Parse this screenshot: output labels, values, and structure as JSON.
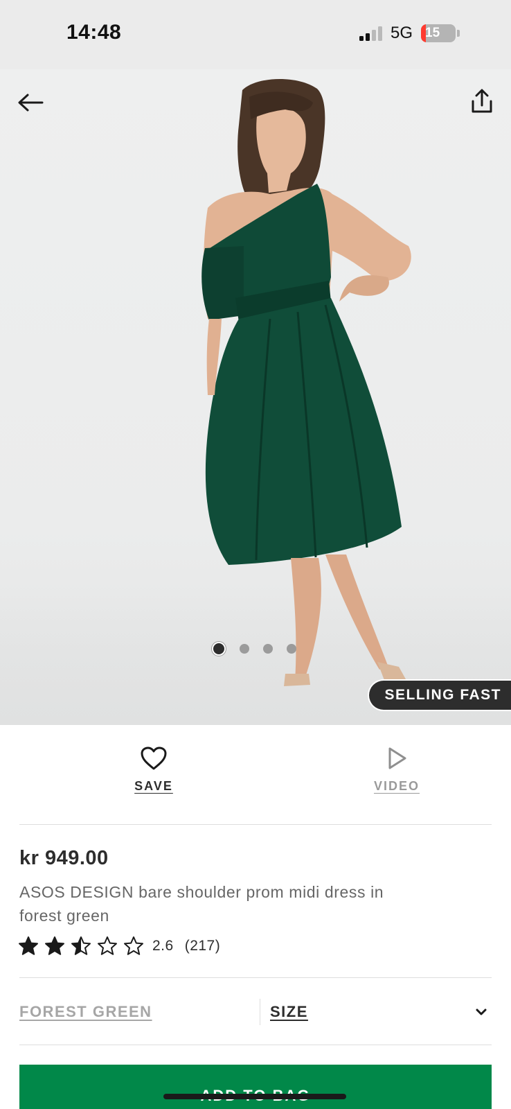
{
  "status_bar": {
    "time": "14:48",
    "network": "5G",
    "battery": "15"
  },
  "hero": {
    "back_icon": "arrow-left-icon",
    "share_icon": "share-icon",
    "badge": "SELLING FAST",
    "carousel": {
      "count": 4,
      "active_index": 0
    }
  },
  "actions": {
    "save_label": "SAVE",
    "save_icon": "heart-icon",
    "video_label": "VIDEO",
    "video_icon": "play-icon"
  },
  "product": {
    "price": "kr 949.00",
    "title": "ASOS DESIGN bare shoulder prom midi dress in forest green",
    "rating": {
      "value": 2.5,
      "score_text": "2.6",
      "count_text": "(217)",
      "max": 5
    }
  },
  "options": {
    "colour": "FOREST GREEN",
    "size_label": "SIZE"
  },
  "cta": {
    "label": "ADD TO BAG"
  },
  "colors": {
    "accent_green": "#018849",
    "dark": "#2d2d2d",
    "dress_green": "#0f4a37"
  }
}
